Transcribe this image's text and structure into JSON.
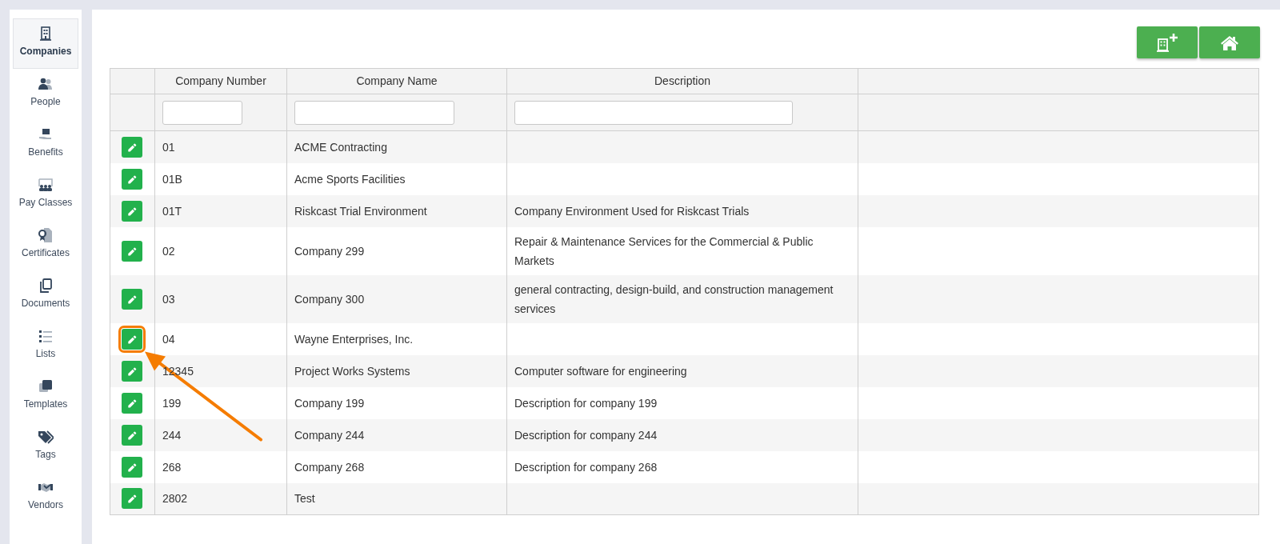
{
  "sidebar": {
    "items": [
      {
        "kind": "companies",
        "label": "Companies",
        "selected": true
      },
      {
        "kind": "people",
        "label": "People",
        "selected": false
      },
      {
        "kind": "benefits",
        "label": "Benefits",
        "selected": false
      },
      {
        "kind": "payclasses",
        "label": "Pay Classes",
        "selected": false
      },
      {
        "kind": "certificates",
        "label": "Certificates",
        "selected": false
      },
      {
        "kind": "documents",
        "label": "Documents",
        "selected": false
      },
      {
        "kind": "lists",
        "label": "Lists",
        "selected": false
      },
      {
        "kind": "templates",
        "label": "Templates",
        "selected": false
      },
      {
        "kind": "tags",
        "label": "Tags",
        "selected": false
      },
      {
        "kind": "vendors",
        "label": "Vendors",
        "selected": false
      }
    ]
  },
  "toolbar": {
    "buttons": [
      {
        "kind": "add-company"
      },
      {
        "kind": "home"
      }
    ]
  },
  "table": {
    "columns": [
      {
        "filter": false
      },
      {
        "label": "Company Number",
        "filter": true
      },
      {
        "label": "Company Name",
        "filter": true
      },
      {
        "label": "Description",
        "filter": true
      },
      {
        "filter": false
      }
    ],
    "rows": [
      {
        "number": "01",
        "name": "ACME Contracting",
        "callout": false
      },
      {
        "number": "01B",
        "name": "Acme Sports Facilities",
        "callout": false
      },
      {
        "number": "01T",
        "name": "Riskcast Trial Environment",
        "description": "Company Environment Used for Riskcast Trials",
        "callout": false
      },
      {
        "number": "02",
        "name": "Company 299",
        "description": "Repair & Maintenance Services for the Commercial & Public Markets",
        "callout": false
      },
      {
        "number": "03",
        "name": "Company 300",
        "description": "general contracting, design-build, and construction management services",
        "callout": false
      },
      {
        "number": "04",
        "name": "Wayne Enterprises, Inc.",
        "callout": true
      },
      {
        "number": "12345",
        "name": "Project Works Systems",
        "description": "Computer software for engineering",
        "callout": false
      },
      {
        "number": "199",
        "name": "Company 199",
        "description": "Description for company 199",
        "callout": false
      },
      {
        "number": "244",
        "name": "Company 244",
        "description": "Description for company 244",
        "callout": false
      },
      {
        "number": "268",
        "name": "Company 268",
        "description": "Description for company 268",
        "callout": false
      },
      {
        "number": "2802",
        "name": "Test",
        "callout": false
      }
    ]
  }
}
